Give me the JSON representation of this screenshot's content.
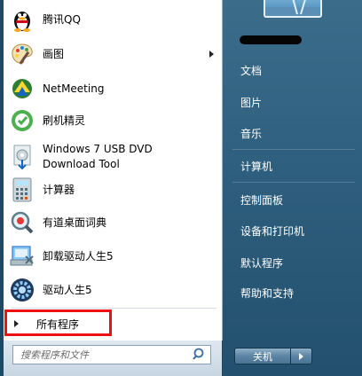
{
  "programs": [
    {
      "label": "腾讯QQ",
      "icon": "qq-penguin-icon",
      "submenu": false
    },
    {
      "label": "画图",
      "icon": "paint-palette-icon",
      "submenu": true
    },
    {
      "label": "NetMeeting",
      "icon": "netmeeting-icon",
      "submenu": false
    },
    {
      "label": "刷机精灵",
      "icon": "shuaji-jingling-icon",
      "submenu": false
    },
    {
      "label": "Windows 7 USB DVD\nDownload Tool",
      "icon": "usb-dvd-tool-icon",
      "submenu": false
    },
    {
      "label": "计算器",
      "icon": "calculator-icon",
      "submenu": false
    },
    {
      "label": "有道桌面词典",
      "icon": "youdao-dict-icon",
      "submenu": false
    },
    {
      "label": "卸载驱动人生5",
      "icon": "uninstall-icon",
      "submenu": false
    },
    {
      "label": "驱动人生5",
      "icon": "driver-gear-icon",
      "submenu": false
    }
  ],
  "all_programs": "所有程序",
  "search": {
    "placeholder": "搜索程序和文件"
  },
  "places": [
    "文档",
    "图片",
    "音乐",
    "计算机",
    "控制面板",
    "设备和打印机",
    "默认程序",
    "帮助和支持"
  ],
  "shutdown_label": "关机",
  "colors": {
    "highlight_border": "#ee1111",
    "right_panel": "#2f5f7e",
    "left_panel": "#ffffff"
  }
}
